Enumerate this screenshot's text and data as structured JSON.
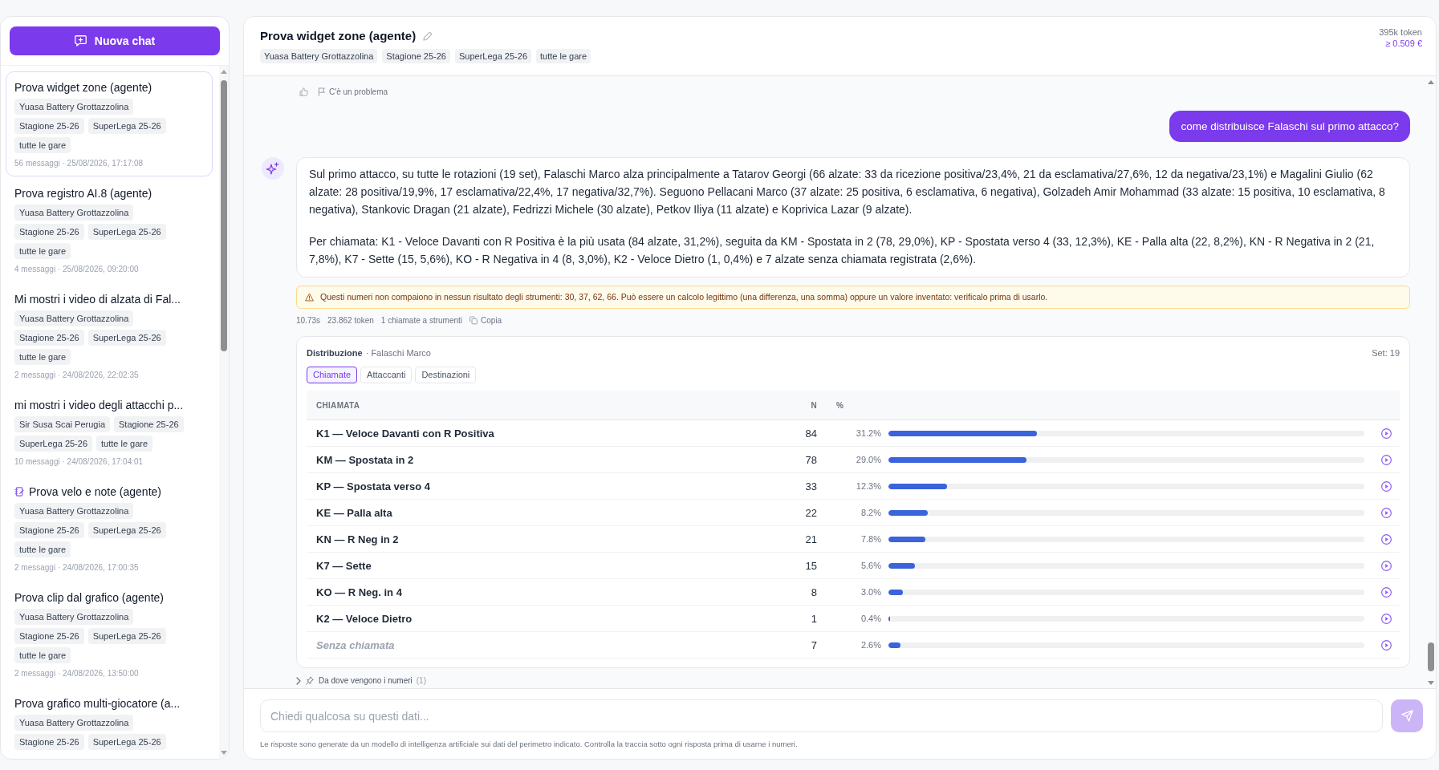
{
  "sidebar": {
    "new_chat_label": "Nuova chat",
    "chats": [
      {
        "kind": "chat",
        "title": "Prova widget zone (agente)",
        "tags": [
          "Yuasa Battery Grottazzolina",
          "Stagione 25-26",
          "SuperLega 25-26",
          "tutte le gare"
        ],
        "meta": "56 messaggi · 25/08/2026, 17:17:08",
        "selected": true
      },
      {
        "kind": "chat",
        "title": "Prova registro AI.8 (agente)",
        "tags": [
          "Yuasa Battery Grottazzolina",
          "Stagione 25-26",
          "SuperLega 25-26",
          "tutte le gare"
        ],
        "meta": "4 messaggi · 25/08/2026, 09:20:00",
        "selected": false
      },
      {
        "kind": "chat",
        "title": "Mi mostri i video di alzata di Fal...",
        "tags": [
          "Yuasa Battery Grottazzolina",
          "Stagione 25-26",
          "SuperLega 25-26",
          "tutte le gare"
        ],
        "meta": "2 messaggi · 24/08/2026, 22:02:35",
        "selected": false
      },
      {
        "kind": "chat",
        "title": "mi mostri i video degli attacchi p...",
        "tags": [
          "Sir Susa Scai Perugia",
          "Stagione 25-26",
          "SuperLega 25-26",
          "tutte le gare"
        ],
        "meta": "10 messaggi · 24/08/2026, 17:04:01",
        "selected": false
      },
      {
        "kind": "notes",
        "title": "Prova velo e note (agente)",
        "tags": [
          "Yuasa Battery Grottazzolina",
          "Stagione 25-26",
          "SuperLega 25-26",
          "tutte le gare"
        ],
        "meta": "2 messaggi · 24/08/2026, 17:00:35",
        "selected": false
      },
      {
        "kind": "chat",
        "title": "Prova clip dal grafico (agente)",
        "tags": [
          "Yuasa Battery Grottazzolina",
          "Stagione 25-26",
          "SuperLega 25-26",
          "tutte le gare"
        ],
        "meta": "2 messaggi · 24/08/2026, 13:50:00",
        "selected": false
      },
      {
        "kind": "chat",
        "title": "Prova grafico multi-giocatore (a...",
        "tags": [
          "Yuasa Battery Grottazzolina",
          "Stagione 25-26",
          "SuperLega 25-26"
        ],
        "selected": false
      }
    ]
  },
  "header": {
    "title": "Prova widget zone (agente)",
    "tags": [
      "Yuasa Battery Grottazzolina",
      "Stagione 25-26",
      "SuperLega 25-26",
      "tutte le gare"
    ],
    "tokens": "395k token",
    "cost": "≥ 0.509 €"
  },
  "conversation": {
    "previous_feedback": {
      "report_label": "C'è un problema"
    },
    "messages": [
      {
        "kind": "user",
        "text": "come distribuisce Falaschi sul primo attacco?"
      },
      {
        "kind": "assistant",
        "paragraphs": [
          "Sul primo attacco, su tutte le rotazioni (19 set), Falaschi Marco alza principalmente a Tatarov Georgi (66 alzate: 33 da ricezione positiva/23,4%, 21 da esclamativa/27,6%, 12 da negativa/23,1%) e Magalini Giulio (62 alzate: 28 positiva/19,9%, 17 esclamativa/22,4%, 17 negativa/32,7%). Seguono Pellacani Marco (37 alzate: 25 positiva, 6 esclamativa, 6 negativa), Golzadeh Amir Mohammad (33 alzate: 15 positiva, 10 esclamativa, 8 negativa), Stankovic Dragan (21 alzate), Fedrizzi Michele (30 alzate), Petkov Iliya (11 alzate) e Koprivica Lazar (9 alzate).",
          "Per chiamata: K1 - Veloce Davanti con R Positiva è la più usata (84 alzate, 31,2%), seguita da KM - Spostata in 2 (78, 29,0%), KP - Spostata verso 4 (33, 12,3%), KE - Palla alta (22, 8,2%), KN - R Negativa in 2 (21, 7,8%), K7 - Sette (15, 5,6%), KO - R Negativa in 4 (8, 3,0%), K2 - Veloce Dietro (1, 0,4%) e 7 alzate senza chiamata registrata (2,6%)."
        ],
        "warning": "Questi numeri non compaiono in nessun risultato degli strumenti: 30, 37, 62, 66. Può essere un calcolo legittimo (una differenza, una somma) oppure un valore inventato: verificalo prima di usarlo.",
        "stats": [
          "10.73s",
          "23.862 token",
          "1 chiamate a strumenti"
        ],
        "copy_label": "Copia",
        "widget": {
          "title": "Distribuzione",
          "subtitle": "· Falaschi Marco",
          "sets": "Set: 19",
          "tabs": [
            {
              "label": "Chiamate",
              "selected": true
            },
            {
              "label": "Attaccanti",
              "selected": false
            },
            {
              "label": "Destinazioni",
              "selected": false
            }
          ],
          "columns": [
            "CHIAMATA",
            "N",
            "%"
          ],
          "rows": [
            {
              "kind": "call",
              "label": "K1 — Veloce Davanti con R Positiva",
              "n": "84",
              "pct": "31.2%",
              "level": 0.312
            },
            {
              "kind": "call",
              "label": "KM — Spostata in 2",
              "n": "78",
              "pct": "29.0%",
              "level": 0.29
            },
            {
              "kind": "call",
              "label": "KP — Spostata verso 4",
              "n": "33",
              "pct": "12.3%",
              "level": 0.123
            },
            {
              "kind": "call",
              "label": "KE — Palla alta",
              "n": "22",
              "pct": "8.2%",
              "level": 0.082
            },
            {
              "kind": "call",
              "label": "KN — R Neg in 2",
              "n": "21",
              "pct": "7.8%",
              "level": 0.078
            },
            {
              "kind": "call",
              "label": "K7 — Sette",
              "n": "15",
              "pct": "5.6%",
              "level": 0.056
            },
            {
              "kind": "call",
              "label": "KO — R Neg. in 4",
              "n": "8",
              "pct": "3.0%",
              "level": 0.03
            },
            {
              "kind": "call",
              "label": "K2 — Veloce Dietro",
              "n": "1",
              "pct": "0.4%",
              "level": 0.004
            },
            {
              "kind": "uncalled",
              "label": "Senza chiamata",
              "n": "7",
              "pct": "2.6%",
              "level": 0.026
            }
          ]
        },
        "sources": {
          "label": "Da dove vengono i numeri",
          "count": "(1)"
        }
      }
    ]
  },
  "composer": {
    "placeholder": "Chiedi qualcosa su questi dati...",
    "send_disabled": true,
    "disclaimer": "Le risposte sono generate da un modello di intelligenza artificiale sui dati del perimetro indicato. Controlla la traccia sotto ogni risposta prima di usarne i numeri."
  }
}
